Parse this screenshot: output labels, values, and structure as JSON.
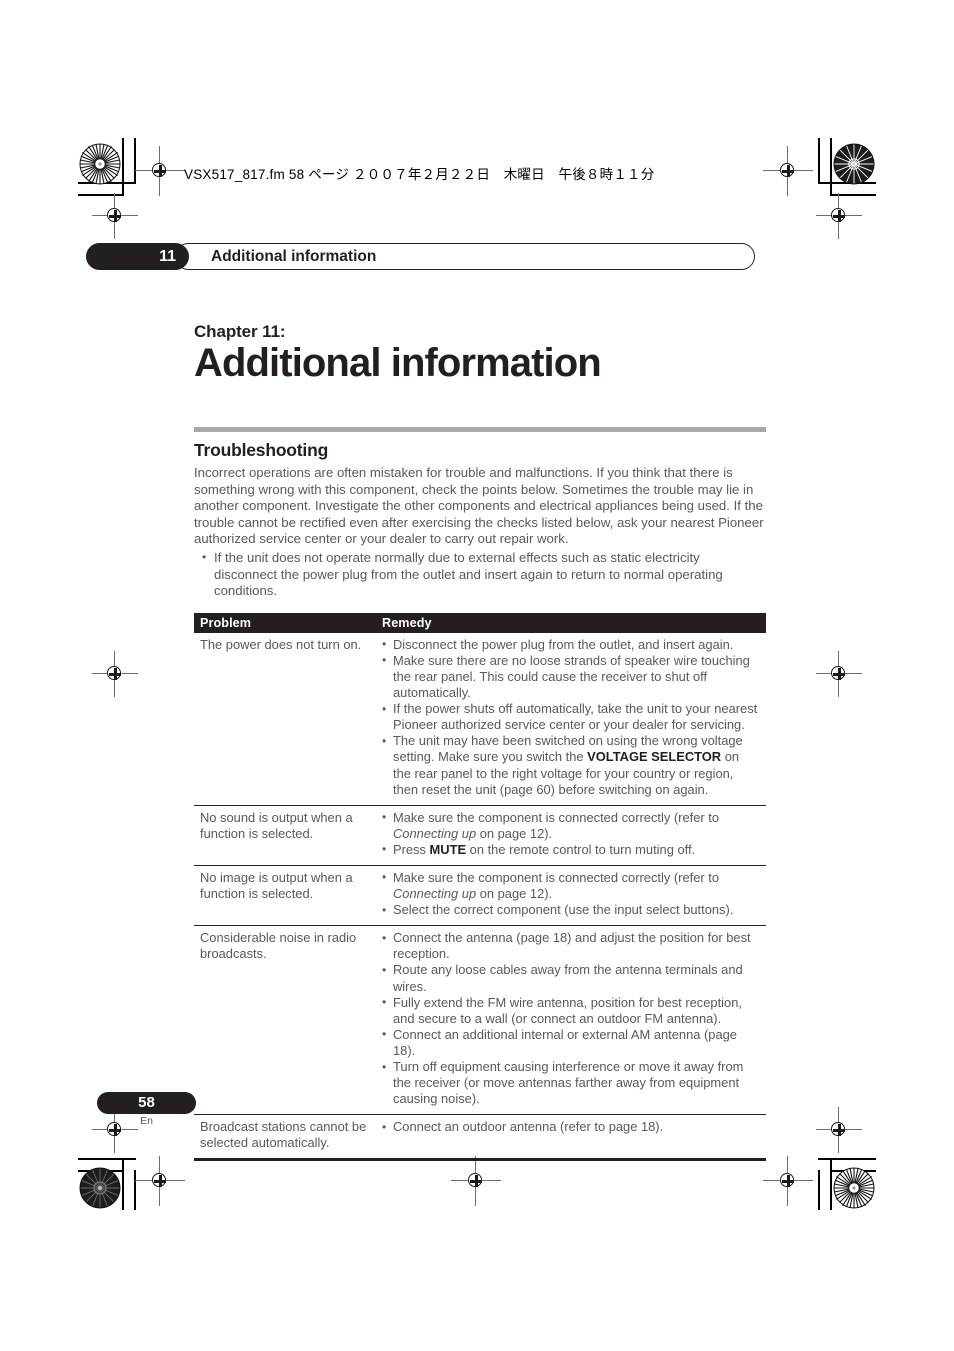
{
  "print_header": {
    "filename_line": "VSX517_817.fm  58 ページ  ２００７年２月２２日　木曜日　午後８時１１分"
  },
  "running_head": {
    "chapter_number": "11",
    "chapter_label": "Additional information"
  },
  "chapter": {
    "kicker": "Chapter 11:",
    "title": "Additional information"
  },
  "section": {
    "title": "Troubleshooting",
    "intro": "Incorrect operations are often mistaken for trouble and malfunctions. If you think that there is something wrong with this component, check the points below. Sometimes the trouble may lie in another component. Investigate the other components and electrical appliances being used. If the trouble cannot be rectified even after exercising the checks listed below, ask your nearest Pioneer authorized service center or your dealer to carry out repair work.",
    "bullets": [
      "If the unit does not operate normally due to external effects such as static electricity disconnect the power plug from the outlet and insert again to return to normal operating conditions."
    ]
  },
  "table": {
    "headers": {
      "problem": "Problem",
      "remedy": "Remedy"
    },
    "rows": [
      {
        "problem": "The power does not turn on.",
        "remedies": [
          "Disconnect the power plug from the outlet, and insert again.",
          "Make sure there are no loose strands of speaker wire touching the rear panel. This could cause the receiver to shut off automatically.",
          "If the power shuts off automatically, take the unit to your nearest Pioneer authorized service center or your dealer for servicing.",
          "The unit may have been switched on using the wrong voltage setting. Make sure you switch the VOLTAGE SELECTOR on the rear panel to the right voltage for your country or region, then reset the unit (page 60) before switching on again."
        ]
      },
      {
        "problem": "No sound is output when a function is selected.",
        "remedies": [
          "Make sure the component is connected correctly (refer to Connecting up on page 12).",
          "Press MUTE on the remote control to turn muting off."
        ]
      },
      {
        "problem": "No image is output when a function is selected.",
        "remedies": [
          "Make sure the component is connected correctly (refer to Connecting up on page 12).",
          "Select the correct component (use the input select buttons)."
        ]
      },
      {
        "problem": "Considerable noise in radio broadcasts.",
        "remedies": [
          "Connect the antenna (page 18) and adjust the position for best reception.",
          "Route any loose cables away from the antenna terminals and wires.",
          "Fully extend the FM wire antenna, position for best reception, and secure to a wall (or connect an outdoor FM antenna).",
          "Connect an additional internal or external AM antenna (page 18).",
          "Turn off equipment causing interference or move it away from the receiver (or move antennas farther away from equipment causing noise)."
        ]
      },
      {
        "problem": "Broadcast stations cannot be selected automatically.",
        "remedies": [
          "Connect an outdoor antenna (refer to page 18)."
        ]
      }
    ]
  },
  "footer": {
    "page_number": "58",
    "language_code": "En"
  },
  "colors": {
    "ink_black": "#231f20",
    "body_gray": "#58595b",
    "rule_gray": "#a7a9ac"
  }
}
